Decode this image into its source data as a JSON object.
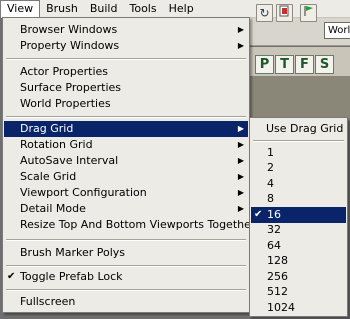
{
  "menubar": {
    "items": [
      "View",
      "Brush",
      "Build",
      "Tools",
      "Help"
    ],
    "active": "View"
  },
  "toolbar": {
    "refresh_icon": "refresh-icon",
    "stop_icon": "stop-icon",
    "flag_icon": "flag-icon",
    "world_combo_value": "World"
  },
  "mode_buttons": [
    "P",
    "T",
    "F",
    "S"
  ],
  "view_menu": {
    "group1": [
      {
        "label": "Browser Windows",
        "submenu": true
      },
      {
        "label": "Property Windows",
        "submenu": true
      }
    ],
    "group2": [
      {
        "label": "Actor Properties"
      },
      {
        "label": "Surface Properties"
      },
      {
        "label": "World Properties"
      }
    ],
    "group3": [
      {
        "label": "Drag Grid",
        "submenu": true,
        "highlighted": true
      },
      {
        "label": "Rotation Grid",
        "submenu": true
      },
      {
        "label": "AutoSave Interval",
        "submenu": true
      },
      {
        "label": "Scale Grid",
        "submenu": true
      },
      {
        "label": "Viewport Configuration",
        "submenu": true
      },
      {
        "label": "Detail Mode",
        "submenu": true
      },
      {
        "label": "Resize Top And Bottom Viewports Together"
      }
    ],
    "group4": [
      {
        "label": "Brush Marker Polys"
      }
    ],
    "group5": [
      {
        "label": "Toggle Prefab Lock",
        "checked": true
      }
    ],
    "group6": [
      {
        "label": "Fullscreen"
      }
    ]
  },
  "drag_grid_submenu": {
    "toggle": {
      "label": "Use Drag Grid"
    },
    "sizes": [
      {
        "label": "1"
      },
      {
        "label": "2"
      },
      {
        "label": "4"
      },
      {
        "label": "8"
      },
      {
        "label": "16",
        "checked": true,
        "highlighted": true
      },
      {
        "label": "32"
      },
      {
        "label": "64"
      },
      {
        "label": "128"
      },
      {
        "label": "256"
      },
      {
        "label": "512"
      },
      {
        "label": "1024"
      }
    ]
  },
  "colors": {
    "highlight": "#0a246a",
    "menu_bg": "#ecebe5"
  }
}
